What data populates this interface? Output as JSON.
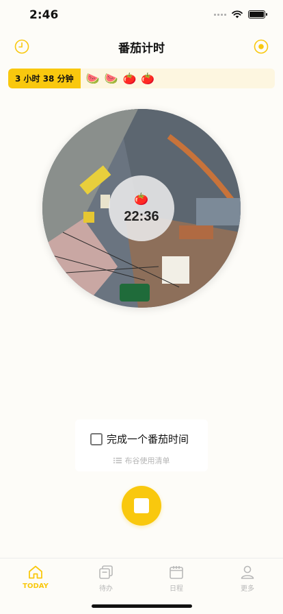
{
  "status_bar": {
    "time": "2:46"
  },
  "header": {
    "title": "番茄计时",
    "left_icon": "clock-icon",
    "right_icon": "target-icon",
    "accent": "#f9c80e"
  },
  "tally": {
    "total_label": "3 小时  38 分钟",
    "items": [
      {
        "emoji": "🍉",
        "icon": "watermelon-icon"
      },
      {
        "emoji": "🍉",
        "icon": "watermelon-icon"
      },
      {
        "emoji": "🍅",
        "icon": "tomato-icon"
      },
      {
        "emoji": "🍅",
        "icon": "tomato-icon"
      }
    ]
  },
  "timer": {
    "emoji": "🍅",
    "time": "22:36"
  },
  "task": {
    "label": "完成一个番茄时间",
    "checked": false,
    "sub_label": "布谷使用清单",
    "sub_icon": "list-icon"
  },
  "controls": {
    "stop_icon": "stop-icon"
  },
  "tabs": [
    {
      "label": "TODAY",
      "icon": "home-icon",
      "active": true
    },
    {
      "label": "待办",
      "icon": "todo-icon",
      "active": false
    },
    {
      "label": "日程",
      "icon": "calendar-icon",
      "active": false
    },
    {
      "label": "更多",
      "icon": "person-icon",
      "active": false
    }
  ],
  "colors": {
    "accent": "#f9c80e",
    "inactive": "#b8b8b8",
    "background": "#fdfcf8"
  }
}
